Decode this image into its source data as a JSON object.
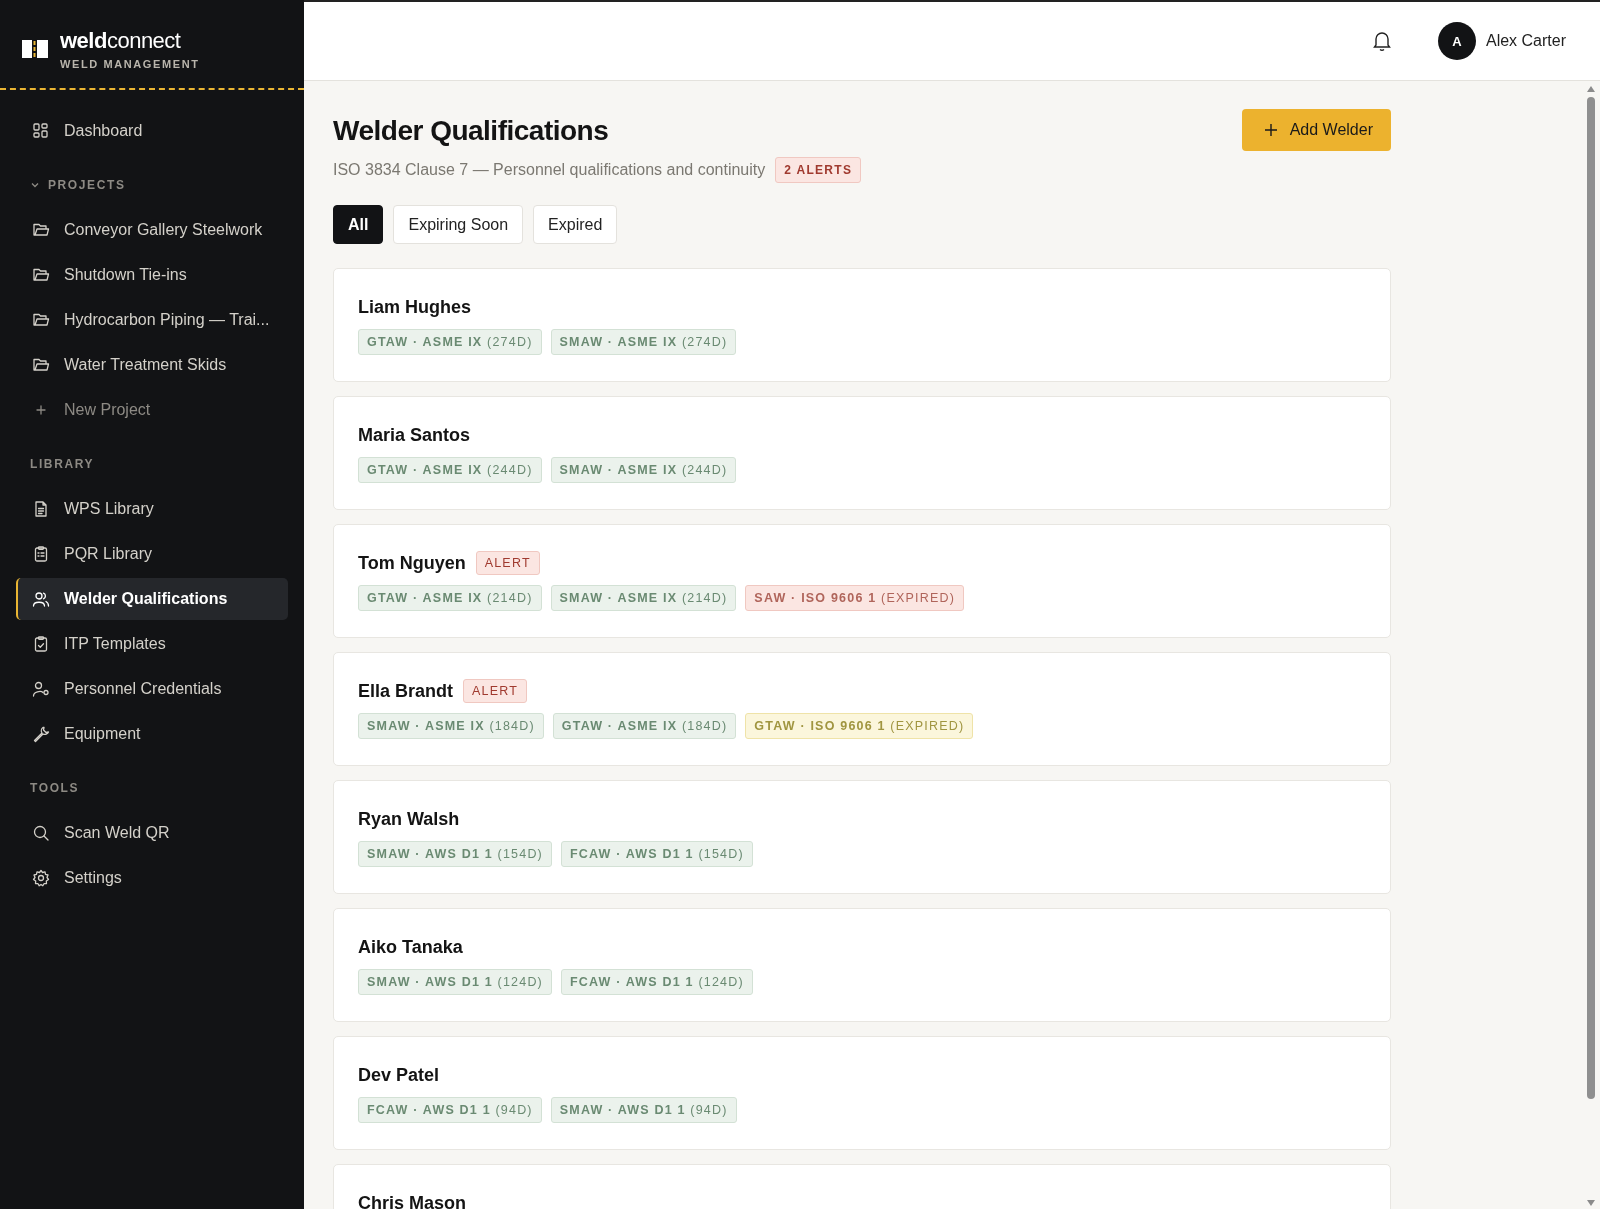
{
  "brand": {
    "name": "**weld**connect",
    "tagline": "WELD MANAGEMENT"
  },
  "sidebar": {
    "top": [
      {
        "label": "Dashboard",
        "selected": false
      }
    ],
    "sections": [
      {
        "title": "PROJECTS",
        "expanded": true,
        "items": [
          {
            "label": "Conveyor Gallery Steelwork",
            "selected": false,
            "kind": "project"
          },
          {
            "label": "Shutdown Tie-ins",
            "selected": false,
            "kind": "project"
          },
          {
            "label": "Hydrocarbon Piping — Trai...",
            "selected": false,
            "kind": "project"
          },
          {
            "label": "Water Treatment Skids",
            "selected": false,
            "kind": "project"
          },
          {
            "label": "New Project",
            "selected": false,
            "kind": "add"
          }
        ]
      },
      {
        "title": "LIBRARY",
        "items": [
          {
            "label": "WPS Library",
            "selected": false,
            "kind": "document"
          },
          {
            "label": "PQR Library",
            "selected": false,
            "kind": "clipboard"
          },
          {
            "label": "Welder Qualifications",
            "selected": true,
            "kind": "people"
          },
          {
            "label": "ITP Templates",
            "selected": false,
            "kind": "checklist"
          },
          {
            "label": "Personnel Credentials",
            "selected": false,
            "kind": "person-gear"
          },
          {
            "label": "Equipment",
            "selected": false,
            "kind": "wrench"
          }
        ]
      },
      {
        "title": "TOOLS",
        "items": [
          {
            "label": "Scan Weld QR",
            "selected": false,
            "kind": "search"
          },
          {
            "label": "Settings",
            "selected": false,
            "kind": "settings"
          }
        ]
      }
    ]
  },
  "header": {
    "user": {
      "initial": "A",
      "name": "Alex Carter"
    }
  },
  "page": {
    "title": "Welder Qualifications",
    "subtitle": "ISO 3834 Clause 7 — Personnel qualifications and continuity",
    "alert_badge": "2 ALERTS",
    "add_button": "Add Welder",
    "filters": [
      {
        "label": "All",
        "selected": true
      },
      {
        "label": "Expiring Soon",
        "selected": false
      },
      {
        "label": "Expired",
        "selected": false
      }
    ]
  },
  "welders": [
    {
      "name": "Liam Hughes",
      "tags": [
        {
          "text": "**GTAW · ASME IX** (274D)",
          "kind": "valid"
        },
        {
          "text": "**SMAW · ASME IX** (274D)",
          "kind": "valid"
        }
      ]
    },
    {
      "name": "Maria Santos",
      "tags": [
        {
          "text": "**GTAW · ASME IX** (244D)",
          "kind": "valid"
        },
        {
          "text": "**SMAW · ASME IX** (244D)",
          "kind": "valid"
        }
      ]
    },
    {
      "name": "Tom Nguyen",
      "alert": "ALERT",
      "tags": [
        {
          "text": "**GTAW · ASME IX** (214D)",
          "kind": "valid"
        },
        {
          "text": "**SMAW · ASME IX** (214D)",
          "kind": "valid"
        },
        {
          "text": "**SAW · ISO 9606 1** (EXPIRED)",
          "kind": "expired"
        }
      ]
    },
    {
      "name": "Ella Brandt",
      "alert": "ALERT",
      "tags": [
        {
          "text": "**SMAW · ASME IX** (184D)",
          "kind": "valid"
        },
        {
          "text": "**GTAW · ASME IX** (184D)",
          "kind": "valid"
        },
        {
          "text": "**GTAW · ISO 9606 1** (EXPIRED)",
          "kind": "warning"
        }
      ]
    },
    {
      "name": "Ryan Walsh",
      "tags": [
        {
          "text": "**SMAW · AWS D1 1** (154D)",
          "kind": "valid"
        },
        {
          "text": "**FCAW · AWS D1 1** (154D)",
          "kind": "valid"
        }
      ]
    },
    {
      "name": "Aiko Tanaka",
      "tags": [
        {
          "text": "**SMAW · AWS D1 1** (124D)",
          "kind": "valid"
        },
        {
          "text": "**FCAW · AWS D1 1** (124D)",
          "kind": "valid"
        }
      ]
    },
    {
      "name": "Dev Patel",
      "tags": [
        {
          "text": "**FCAW · AWS D1 1** (94D)",
          "kind": "valid"
        },
        {
          "text": "**SMAW · AWS D1 1** (94D)",
          "kind": "valid"
        }
      ]
    },
    {
      "name": "Chris Mason"
    }
  ]
}
